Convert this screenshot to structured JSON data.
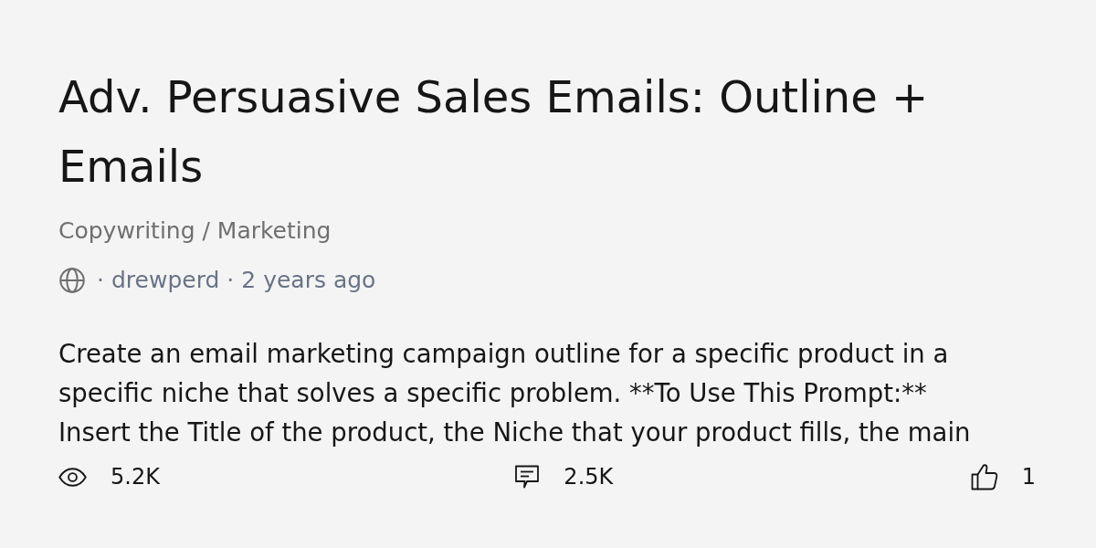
{
  "title": "Adv. Persuasive Sales Emails: Outline + Emails",
  "category": "Copywriting / Marketing",
  "meta": {
    "separator_1": "·",
    "author": "drewperd",
    "separator_2": "·",
    "age": "2 years ago"
  },
  "description": "Create an email marketing campaign outline for a specific product in a specific niche that solves a specific problem. **To Use This Prompt:** Insert the Title of the product, the Niche that your product fills, the main",
  "stats": [
    {
      "kind": "views",
      "count": "5.2K"
    },
    {
      "kind": "comments",
      "count": "2.5K"
    },
    {
      "kind": "likes",
      "count": "1"
    }
  ]
}
